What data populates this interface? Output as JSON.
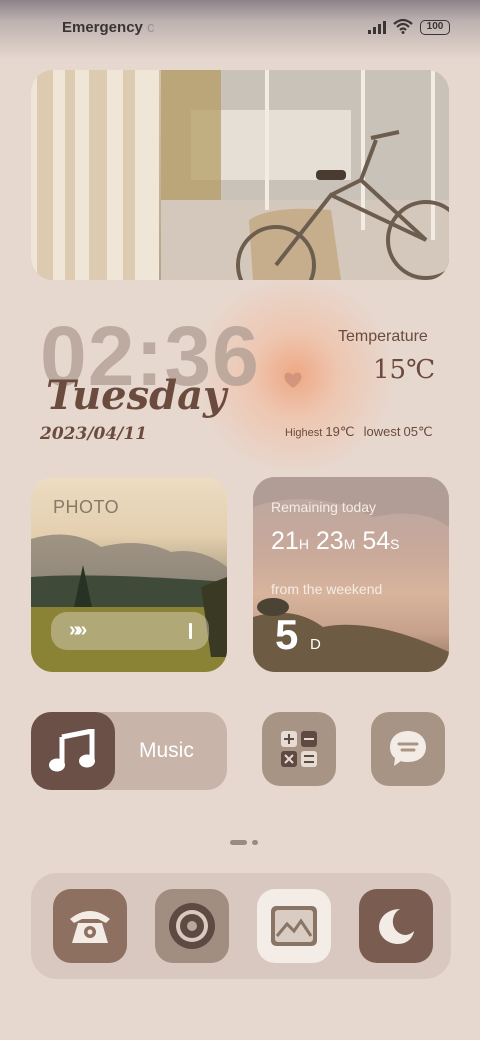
{
  "status_bar": {
    "carrier": "Emergency",
    "carrier_tail": "c",
    "battery": "100"
  },
  "clock": {
    "time": "02:36",
    "day": "Tuesday",
    "date": "2023/04/11"
  },
  "weather": {
    "label": "Temperature",
    "value": "15℃",
    "highest_label": "Highest",
    "highest_value": "19℃",
    "lowest_label": "lowest",
    "lowest_value": "05℃"
  },
  "photo_widget": {
    "label": "PHOTO"
  },
  "countdown_widget": {
    "title": "Remaining today",
    "hours": "21",
    "hours_unit": "H",
    "minutes": "23",
    "minutes_unit": "M",
    "seconds": "54",
    "seconds_unit": "S",
    "weekend_label": "from the weekend",
    "days": "5",
    "days_unit": "D"
  },
  "apps": {
    "music_label": "Music"
  },
  "colors": {
    "background": "#e7d8cf",
    "dark_brown": "#6b5048",
    "taupe": "#a89485"
  },
  "icons": [
    "music-note-icon",
    "calculator-icon",
    "message-icon",
    "phone-icon",
    "camera-icon",
    "gallery-icon",
    "moon-icon",
    "wifi-icon",
    "signal-icon",
    "battery-icon"
  ]
}
